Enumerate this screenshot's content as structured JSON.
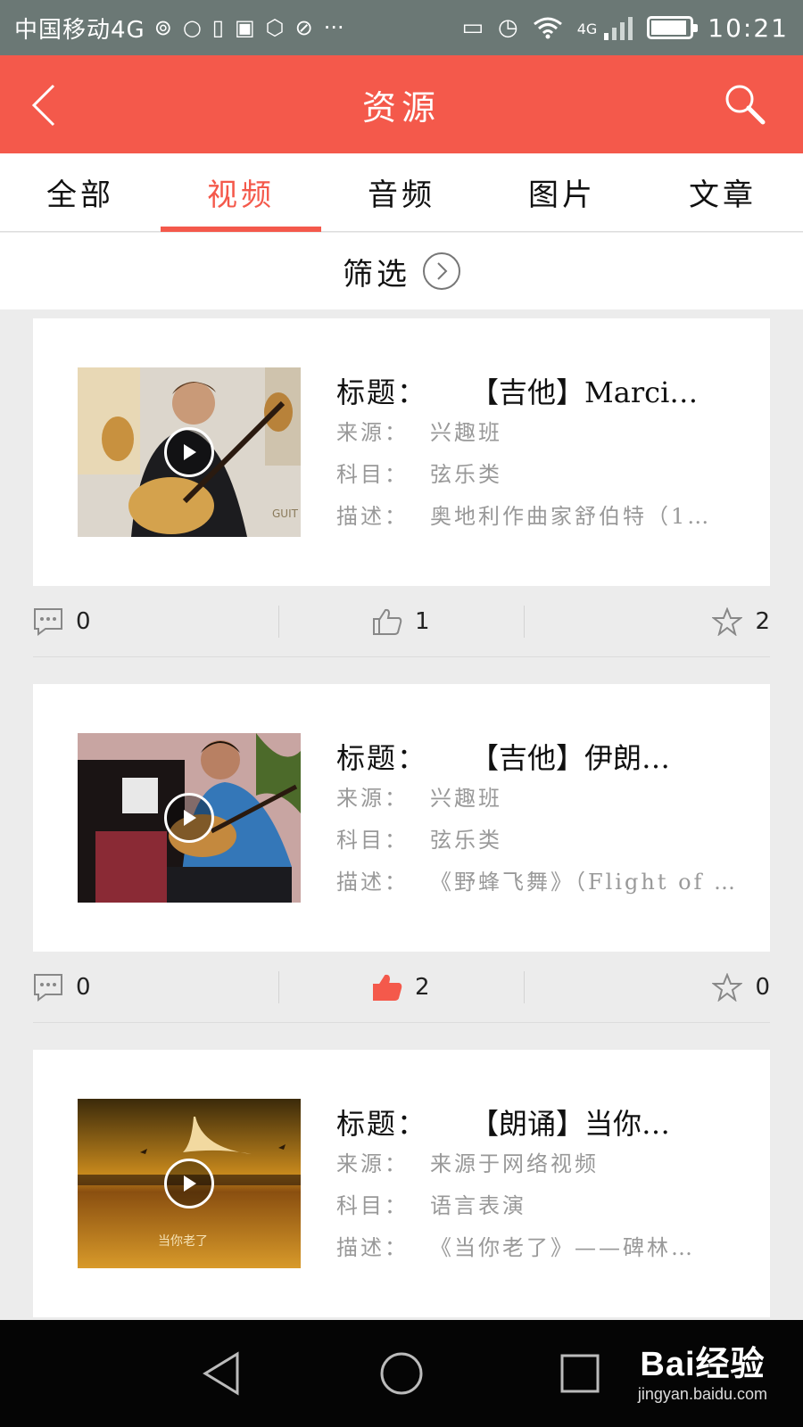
{
  "status_bar": {
    "carrier": "中国移动4G",
    "network_badge": "4G",
    "time": "10:21",
    "battery_level_fraction": 0.85,
    "icons": [
      "hotspot-icon",
      "message-icon",
      "battery-warning-icon",
      "image-icon",
      "shield-icon",
      "no-disturb-icon",
      "more-icon",
      "vibrate-icon",
      "alarm-icon",
      "wifi-icon",
      "signal-icon",
      "battery-icon"
    ]
  },
  "header": {
    "title": "资源",
    "back_icon": "chevron-left-icon",
    "search_icon": "search-icon"
  },
  "tabs": [
    {
      "label": "全部",
      "active": false
    },
    {
      "label": "视频",
      "active": true
    },
    {
      "label": "音频",
      "active": false
    },
    {
      "label": "图片",
      "active": false
    },
    {
      "label": "文章",
      "active": false
    }
  ],
  "filter": {
    "label": "筛选"
  },
  "field_labels": {
    "title": "标题：",
    "source": "来源：",
    "subject": "科目：",
    "description": "描述："
  },
  "items": [
    {
      "title": "【吉他】Marci…",
      "source": "兴趣班",
      "subject": "弦乐类",
      "description": "奥地利作曲家舒伯特（1…",
      "comments": "0",
      "likes": "1",
      "liked": false,
      "favorites": "2"
    },
    {
      "title": "【吉他】伊朗…",
      "source": "兴趣班",
      "subject": "弦乐类",
      "description": "《野蜂飞舞》（Flight of …",
      "comments": "0",
      "likes": "2",
      "liked": true,
      "favorites": "0"
    },
    {
      "title": "【朗诵】当你…",
      "source": "来源于网络视频",
      "subject": "语言表演",
      "description": "《当你老了》——碑林…",
      "comments": "",
      "likes": "",
      "liked": false,
      "favorites": ""
    }
  ],
  "thumbnail_caption_3": "当你老了",
  "watermark": {
    "brand": "Bai经验",
    "url": "jingyan.baidu.com"
  },
  "colors": {
    "accent": "#f4594b",
    "status_bar": "#6b7875",
    "muted_text": "#999999"
  }
}
